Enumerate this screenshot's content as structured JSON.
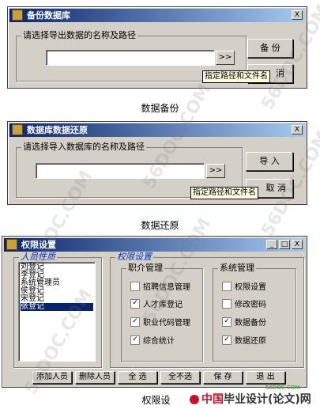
{
  "backup_dialog": {
    "title": "备份数据库",
    "group_label": "请选择导出数据的名称及路径",
    "path_value": "",
    "browse_label": ">>",
    "tooltip": "指定路径和文件名",
    "backup_button": "备 份",
    "cancel_button": "消",
    "close_label": "X"
  },
  "backup_caption": "数据备份",
  "restore_dialog": {
    "title": "数据库数据还原",
    "group_label": "请选择导入数据库的名称及路径",
    "path_value": "",
    "browse_label": ">>",
    "tooltip": "指定路径和文件名",
    "import_button": "导 入",
    "cancel_button": "取 消",
    "close_label": "X"
  },
  "restore_caption": "数据还原",
  "permission_dialog": {
    "title": "权限设置",
    "min_label": "_",
    "max_label": "□",
    "close_label": "X",
    "personnel_group": "人员性质",
    "personnel": [
      "刘登记",
      "李登记",
      "系统管理员",
      "侯登记",
      "宋登记",
      "张登记"
    ],
    "selected_index": 5,
    "permission_group": "权限设置",
    "job_group": "职介管理",
    "job_items": [
      {
        "label": "招聘信息管理",
        "checked": false
      },
      {
        "label": "人才库登记",
        "checked": true
      },
      {
        "label": "职业代码管理",
        "checked": true
      },
      {
        "label": "综合统计",
        "checked": true
      }
    ],
    "system_group": "系统管理",
    "system_items": [
      {
        "label": "权限设置",
        "checked": false
      },
      {
        "label": "修改密码",
        "checked": false
      },
      {
        "label": "数据备份",
        "checked": true
      },
      {
        "label": "数据还原",
        "checked": true
      }
    ],
    "buttons": {
      "add": "添加人员",
      "delete": "删除人员",
      "select_all": "全 选",
      "select_none": "全不选",
      "save": "保 存",
      "exit": "退 出"
    }
  },
  "permission_caption": "权限设",
  "watermarks": [
    "56DOC.COM",
    "56DOC.COM",
    "56DOC.COM",
    "56DOC.COM",
    "56DOC.COM",
    "56DOC.COM"
  ],
  "footer_logo": {
    "prefix": "中国",
    "main": "毕业设计(论文)网",
    "url": "56DOC.COM"
  },
  "colors": {
    "title_start": "#0a246a",
    "title_end": "#a6caf0",
    "face": "#d4d0c8",
    "tooltip": "#ffffe1",
    "logo_red": "#c8102e"
  },
  "icons": {
    "app": "app-icon",
    "check": "check-icon"
  }
}
